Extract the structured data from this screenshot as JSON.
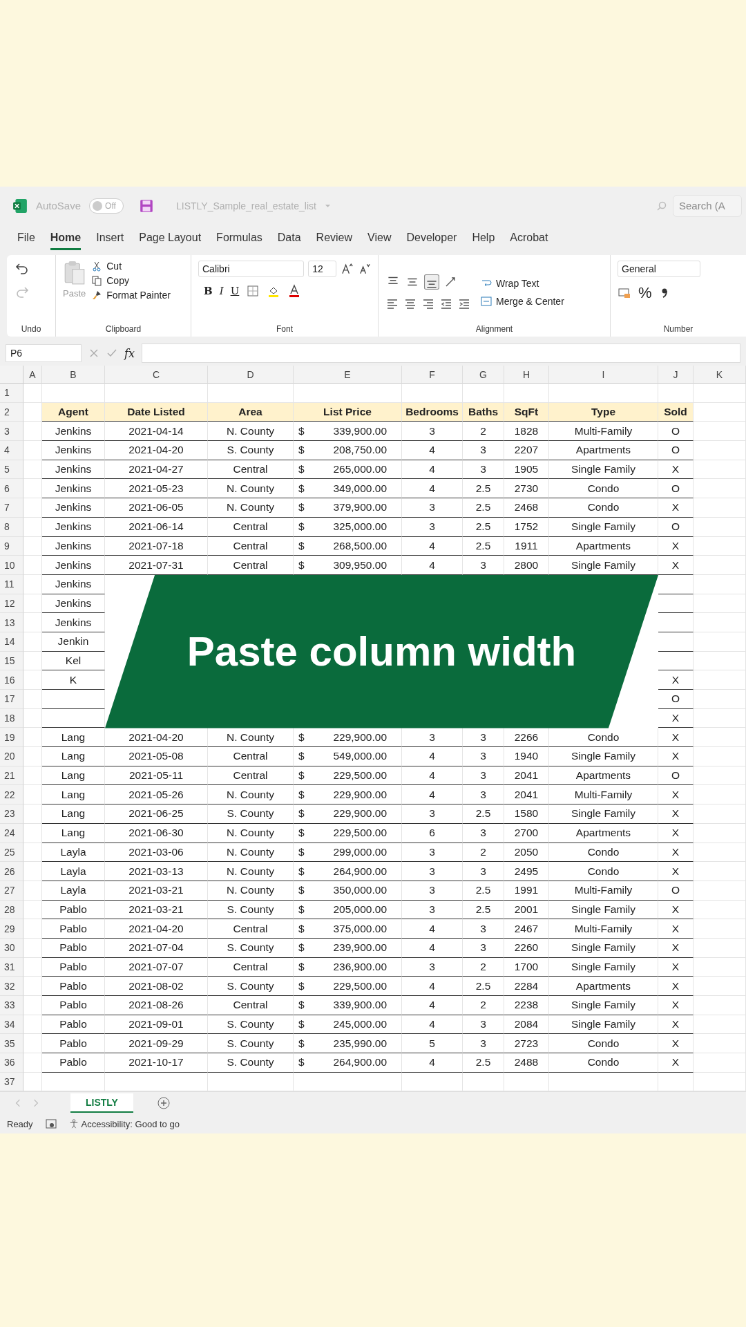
{
  "title_bar": {
    "autosave_label": "AutoSave",
    "autosave_on": false,
    "autosave_state": "Off",
    "file_name": "LISTLY_Sample_real_estate_list",
    "search_placeholder": "Search (A"
  },
  "menu_tabs": [
    {
      "label": "File",
      "selected": false
    },
    {
      "label": "Home",
      "selected": true
    },
    {
      "label": "Insert",
      "selected": false
    },
    {
      "label": "Page Layout",
      "selected": false
    },
    {
      "label": "Formulas",
      "selected": false
    },
    {
      "label": "Data",
      "selected": false
    },
    {
      "label": "Review",
      "selected": false
    },
    {
      "label": "View",
      "selected": false
    },
    {
      "label": "Developer",
      "selected": false
    },
    {
      "label": "Help",
      "selected": false
    },
    {
      "label": "Acrobat",
      "selected": false
    }
  ],
  "ribbon": {
    "undo": {
      "label": "Undo"
    },
    "clipboard": {
      "paste": "Paste",
      "cut": "Cut",
      "copy": "Copy",
      "format_painter": "Format Painter",
      "label": "Clipboard"
    },
    "font": {
      "name": "Calibri",
      "size": "12",
      "bold": "B",
      "italic": "I",
      "underline": "U",
      "label": "Font"
    },
    "alignment": {
      "vertical": [
        {
          "selected": false
        },
        {
          "selected": false
        },
        {
          "selected": true
        }
      ],
      "wrap_text": "Wrap Text",
      "merge_center": "Merge & Center",
      "label": "Alignment"
    },
    "number": {
      "format": "General",
      "percent": "%",
      "label": "Number"
    }
  },
  "formula_bar": {
    "name_box": "P6",
    "fx": "fx"
  },
  "columns": [
    "A",
    "B",
    "C",
    "D",
    "E",
    "F",
    "G",
    "H",
    "I",
    "J",
    "K"
  ],
  "rows": [
    {
      "number": "1",
      "kind": "empty"
    },
    {
      "number": "2",
      "kind": "header",
      "cells": [
        "Agent",
        "Date Listed",
        "Area",
        null,
        "List Price",
        "Bedrooms",
        "Baths",
        "SqFt",
        "Type",
        "Sold"
      ]
    },
    {
      "number": "3",
      "kind": "data",
      "cells": [
        "Jenkins",
        "2021-04-14",
        "N. County",
        "$",
        "339,900.00",
        "3",
        "2",
        "1828",
        "Multi-Family",
        "O"
      ]
    },
    {
      "number": "4",
      "kind": "data",
      "cells": [
        "Jenkins",
        "2021-04-20",
        "S. County",
        "$",
        "208,750.00",
        "4",
        "3",
        "2207",
        "Apartments",
        "O"
      ]
    },
    {
      "number": "5",
      "kind": "data",
      "cells": [
        "Jenkins",
        "2021-04-27",
        "Central",
        "$",
        "265,000.00",
        "4",
        "3",
        "1905",
        "Single Family",
        "X"
      ]
    },
    {
      "number": "6",
      "kind": "data",
      "cells": [
        "Jenkins",
        "2021-05-23",
        "N. County",
        "$",
        "349,000.00",
        "4",
        "2.5",
        "2730",
        "Condo",
        "O"
      ]
    },
    {
      "number": "7",
      "kind": "data",
      "cells": [
        "Jenkins",
        "2021-06-05",
        "N. County",
        "$",
        "379,900.00",
        "3",
        "2.5",
        "2468",
        "Condo",
        "X"
      ]
    },
    {
      "number": "8",
      "kind": "data",
      "cells": [
        "Jenkins",
        "2021-06-14",
        "Central",
        "$",
        "325,000.00",
        "3",
        "2.5",
        "1752",
        "Single Family",
        "O"
      ]
    },
    {
      "number": "9",
      "kind": "data",
      "cells": [
        "Jenkins",
        "2021-07-18",
        "Central",
        "$",
        "268,500.00",
        "4",
        "2.5",
        "1911",
        "Apartments",
        "X"
      ]
    },
    {
      "number": "10",
      "kind": "data",
      "cells": [
        "Jenkins",
        "2021-07-31",
        "Central",
        "$",
        "309,950.00",
        "4",
        "3",
        "2800",
        "Single Family",
        "X"
      ]
    },
    {
      "number": "11",
      "kind": "data",
      "cells": [
        "Jenkins",
        null,
        null,
        null,
        null,
        null,
        null,
        null,
        null,
        null
      ]
    },
    {
      "number": "12",
      "kind": "data",
      "cells": [
        "Jenkins",
        null,
        null,
        null,
        null,
        null,
        null,
        null,
        null,
        null
      ]
    },
    {
      "number": "13",
      "kind": "data",
      "cells": [
        "Jenkins",
        null,
        null,
        null,
        null,
        null,
        null,
        null,
        null,
        null
      ]
    },
    {
      "number": "14",
      "kind": "data",
      "cells": [
        "Jenkin",
        null,
        null,
        null,
        null,
        null,
        null,
        null,
        null,
        null
      ]
    },
    {
      "number": "15",
      "kind": "data",
      "cells": [
        "Kel",
        null,
        null,
        null,
        null,
        null,
        null,
        null,
        null,
        null
      ]
    },
    {
      "number": "16",
      "kind": "data",
      "cells": [
        "K",
        null,
        null,
        null,
        null,
        null,
        null,
        null,
        null,
        "X"
      ]
    },
    {
      "number": "17",
      "kind": "data",
      "cells": [
        null,
        null,
        null,
        null,
        null,
        null,
        null,
        null,
        null,
        "O"
      ]
    },
    {
      "number": "18",
      "kind": "data",
      "cells": [
        null,
        null,
        null,
        null,
        null,
        null,
        null,
        null,
        null,
        "X"
      ]
    },
    {
      "number": "19",
      "kind": "data",
      "cells": [
        "Lang",
        "2021-04-20",
        "N. County",
        "$",
        "229,900.00",
        "3",
        "3",
        "2266",
        "Condo",
        "X"
      ]
    },
    {
      "number": "20",
      "kind": "data",
      "cells": [
        "Lang",
        "2021-05-08",
        "Central",
        "$",
        "549,000.00",
        "4",
        "3",
        "1940",
        "Single Family",
        "X"
      ]
    },
    {
      "number": "21",
      "kind": "data",
      "cells": [
        "Lang",
        "2021-05-11",
        "Central",
        "$",
        "229,500.00",
        "4",
        "3",
        "2041",
        "Apartments",
        "O"
      ]
    },
    {
      "number": "22",
      "kind": "data",
      "cells": [
        "Lang",
        "2021-05-26",
        "N. County",
        "$",
        "229,900.00",
        "4",
        "3",
        "2041",
        "Multi-Family",
        "X"
      ]
    },
    {
      "number": "23",
      "kind": "data",
      "cells": [
        "Lang",
        "2021-06-25",
        "S. County",
        "$",
        "229,900.00",
        "3",
        "2.5",
        "1580",
        "Single Family",
        "X"
      ]
    },
    {
      "number": "24",
      "kind": "data",
      "cells": [
        "Lang",
        "2021-06-30",
        "N. County",
        "$",
        "229,500.00",
        "6",
        "3",
        "2700",
        "Apartments",
        "X"
      ]
    },
    {
      "number": "25",
      "kind": "data",
      "cells": [
        "Layla",
        "2021-03-06",
        "N. County",
        "$",
        "299,000.00",
        "3",
        "2",
        "2050",
        "Condo",
        "X"
      ]
    },
    {
      "number": "26",
      "kind": "data",
      "cells": [
        "Layla",
        "2021-03-13",
        "N. County",
        "$",
        "264,900.00",
        "3",
        "3",
        "2495",
        "Condo",
        "X"
      ]
    },
    {
      "number": "27",
      "kind": "data",
      "cells": [
        "Layla",
        "2021-03-21",
        "N. County",
        "$",
        "350,000.00",
        "3",
        "2.5",
        "1991",
        "Multi-Family",
        "O"
      ]
    },
    {
      "number": "28",
      "kind": "data",
      "cells": [
        "Pablo",
        "2021-03-21",
        "S. County",
        "$",
        "205,000.00",
        "3",
        "2.5",
        "2001",
        "Single Family",
        "X"
      ]
    },
    {
      "number": "29",
      "kind": "data",
      "cells": [
        "Pablo",
        "2021-04-20",
        "Central",
        "$",
        "375,000.00",
        "4",
        "3",
        "2467",
        "Multi-Family",
        "X"
      ]
    },
    {
      "number": "30",
      "kind": "data",
      "cells": [
        "Pablo",
        "2021-07-04",
        "S. County",
        "$",
        "239,900.00",
        "4",
        "3",
        "2260",
        "Single Family",
        "X"
      ]
    },
    {
      "number": "31",
      "kind": "data",
      "cells": [
        "Pablo",
        "2021-07-07",
        "Central",
        "$",
        "236,900.00",
        "3",
        "2",
        "1700",
        "Single Family",
        "X"
      ]
    },
    {
      "number": "32",
      "kind": "data",
      "cells": [
        "Pablo",
        "2021-08-02",
        "S. County",
        "$",
        "229,500.00",
        "4",
        "2.5",
        "2284",
        "Apartments",
        "X"
      ]
    },
    {
      "number": "33",
      "kind": "data",
      "cells": [
        "Pablo",
        "2021-08-26",
        "Central",
        "$",
        "339,900.00",
        "4",
        "2",
        "2238",
        "Single Family",
        "X"
      ]
    },
    {
      "number": "34",
      "kind": "data",
      "cells": [
        "Pablo",
        "2021-09-01",
        "S. County",
        "$",
        "245,000.00",
        "4",
        "3",
        "2084",
        "Single Family",
        "X"
      ]
    },
    {
      "number": "35",
      "kind": "data",
      "cells": [
        "Pablo",
        "2021-09-29",
        "S. County",
        "$",
        "235,990.00",
        "5",
        "3",
        "2723",
        "Condo",
        "X"
      ]
    },
    {
      "number": "36",
      "kind": "data",
      "cells": [
        "Pablo",
        "2021-10-17",
        "S. County",
        "$",
        "264,900.00",
        "4",
        "2.5",
        "2488",
        "Condo",
        "X"
      ]
    },
    {
      "number": "37",
      "kind": "empty"
    }
  ],
  "banner": {
    "text": "Paste column width"
  },
  "sheet_tabs": [
    {
      "label": "LISTLY",
      "selected": true
    }
  ],
  "status_bar": {
    "ready": "Ready",
    "accessibility": "Accessibility: Good to go"
  }
}
